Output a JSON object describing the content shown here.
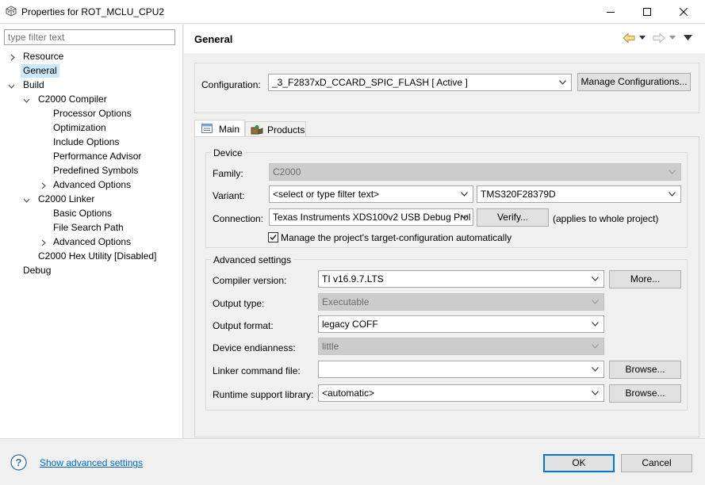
{
  "window": {
    "title": "Properties for ROT_MCLU_CPU2"
  },
  "filter": {
    "placeholder": "type filter text"
  },
  "tree": [
    {
      "label": "Resource"
    },
    {
      "label": "General"
    },
    {
      "label": "Build"
    },
    {
      "label": "C2000 Compiler"
    },
    {
      "label": "Processor Options"
    },
    {
      "label": "Optimization"
    },
    {
      "label": "Include Options"
    },
    {
      "label": "Performance Advisor"
    },
    {
      "label": "Predefined Symbols"
    },
    {
      "label": "Advanced Options"
    },
    {
      "label": "C2000 Linker"
    },
    {
      "label": "Basic Options"
    },
    {
      "label": "File Search Path"
    },
    {
      "label": "Advanced Options"
    },
    {
      "label": "C2000 Hex Utility  [Disabled]"
    },
    {
      "label": "Debug"
    }
  ],
  "page": {
    "title": "General"
  },
  "configuration": {
    "label": "Configuration:",
    "value": "_3_F2837xD_CCARD_SPIC_FLASH  [ Active ]",
    "manage_button": "Manage Configurations..."
  },
  "tabs": {
    "main": "Main",
    "products": "Products"
  },
  "device": {
    "group_title": "Device",
    "family_label": "Family:",
    "family_value": "C2000",
    "variant_label": "Variant:",
    "variant_filter": "<select or type filter text>",
    "variant_value": "TMS320F28379D",
    "connection_label": "Connection:",
    "connection_value": "Texas Instruments XDS100v2 USB Debug Prol",
    "verify_button": "Verify...",
    "applies_note": "(applies to whole project)",
    "manage_checkbox": "Manage the project's target-configuration automatically",
    "manage_checked": true
  },
  "advanced": {
    "group_title": "Advanced settings",
    "compiler_label": "Compiler version:",
    "compiler_value": "TI v16.9.7.LTS",
    "more_button": "More...",
    "output_type_label": "Output type:",
    "output_type_value": "Executable",
    "output_format_label": "Output format:",
    "output_format_value": "legacy COFF",
    "endianness_label": "Device endianness:",
    "endianness_value": "little",
    "linker_cmd_label": "Linker command file:",
    "linker_cmd_value": "",
    "browse_button_1": "Browse...",
    "runtime_label": "Runtime support library:",
    "runtime_value": "<automatic>",
    "browse_button_2": "Browse..."
  },
  "footer": {
    "advanced_link": "Show advanced settings",
    "ok_button": "OK",
    "cancel_button": "Cancel"
  }
}
